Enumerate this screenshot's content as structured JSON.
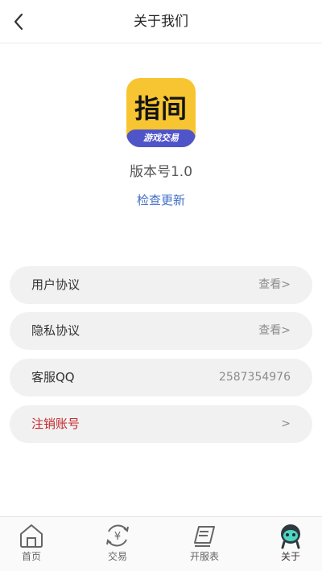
{
  "header": {
    "title": "关于我们",
    "back_icon": "chevron-left-icon"
  },
  "logo": {
    "main_text": "指间",
    "band_text": "游戏交易",
    "background_color": "#f7c531",
    "band_color": "#4f55c8"
  },
  "version_text": "版本号1.0",
  "check_update_label": "检查更新",
  "rows": [
    {
      "label": "用户协议",
      "value": "查看>"
    },
    {
      "label": "隐私协议",
      "value": "查看>"
    },
    {
      "label": "客服QQ",
      "value": "2587354976"
    },
    {
      "label": "注销账号",
      "value": ">"
    }
  ],
  "tabs": [
    {
      "label": "首页",
      "icon": "home-icon"
    },
    {
      "label": "交易",
      "icon": "trade-icon"
    },
    {
      "label": "开服表",
      "icon": "server-list-icon"
    },
    {
      "label": "关于",
      "icon": "about-icon",
      "active": true
    }
  ],
  "colors": {
    "link": "#3f6ec5",
    "danger": "#c4282b",
    "row_bg": "#f1f1f1"
  }
}
